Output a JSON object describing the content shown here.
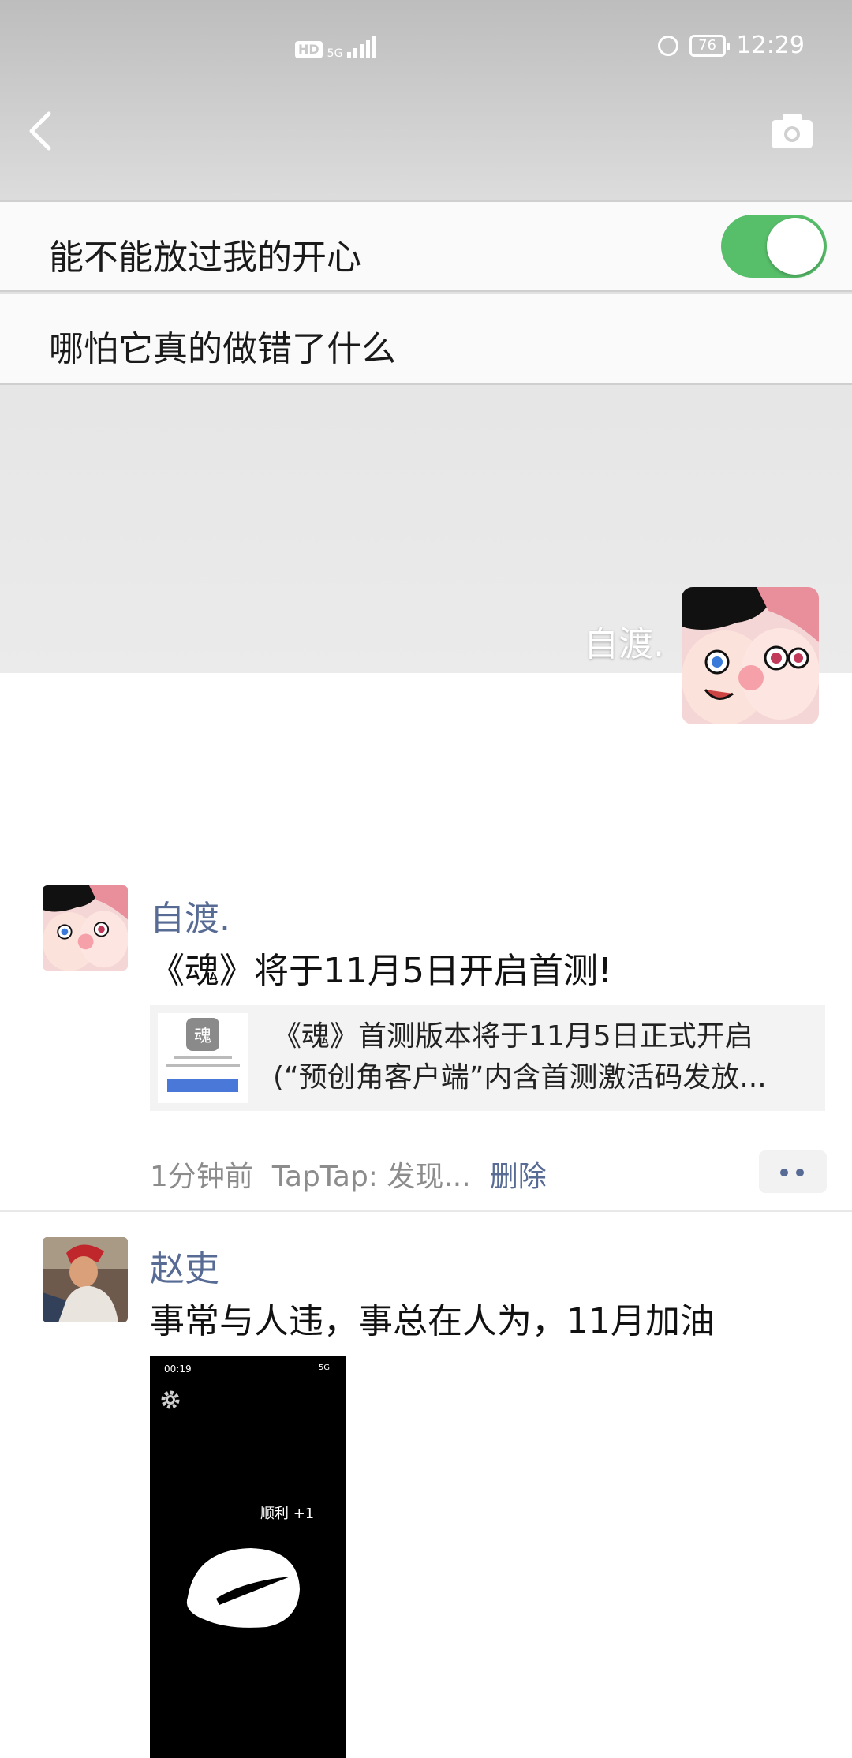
{
  "status_bar": {
    "network_hd": "HD",
    "network_5g": "5G",
    "battery": "76",
    "time": "12:29"
  },
  "nav": {
    "back_icon": "chevron-left-icon",
    "camera_icon": "camera-icon"
  },
  "settings": {
    "row1_text": "能不能放过我的开心",
    "row1_toggle": "on",
    "row2_text": "哪怕它真的做错了什么"
  },
  "cover": {
    "username": "自渡."
  },
  "posts": [
    {
      "name": "自渡.",
      "text": "《魂》将于11月5日开启首测!",
      "link": {
        "line1": "《魂》首测版本将于11月5日正式开启",
        "line2": "(“预创角客户端”内含首测激活码发放..."
      },
      "time": "1分钟前",
      "source": "TapTap: 发现...",
      "delete": "删除"
    },
    {
      "name": "赵吏",
      "text": "事常与人违，事总在人为，11月加油",
      "photo": {
        "status_time": "00:19",
        "status_right": "5G",
        "caption": "顺利 +1"
      }
    }
  ],
  "colors": {
    "accent_link": "#576b95",
    "toggle_on": "#57be6a",
    "background": "#ffffff"
  }
}
